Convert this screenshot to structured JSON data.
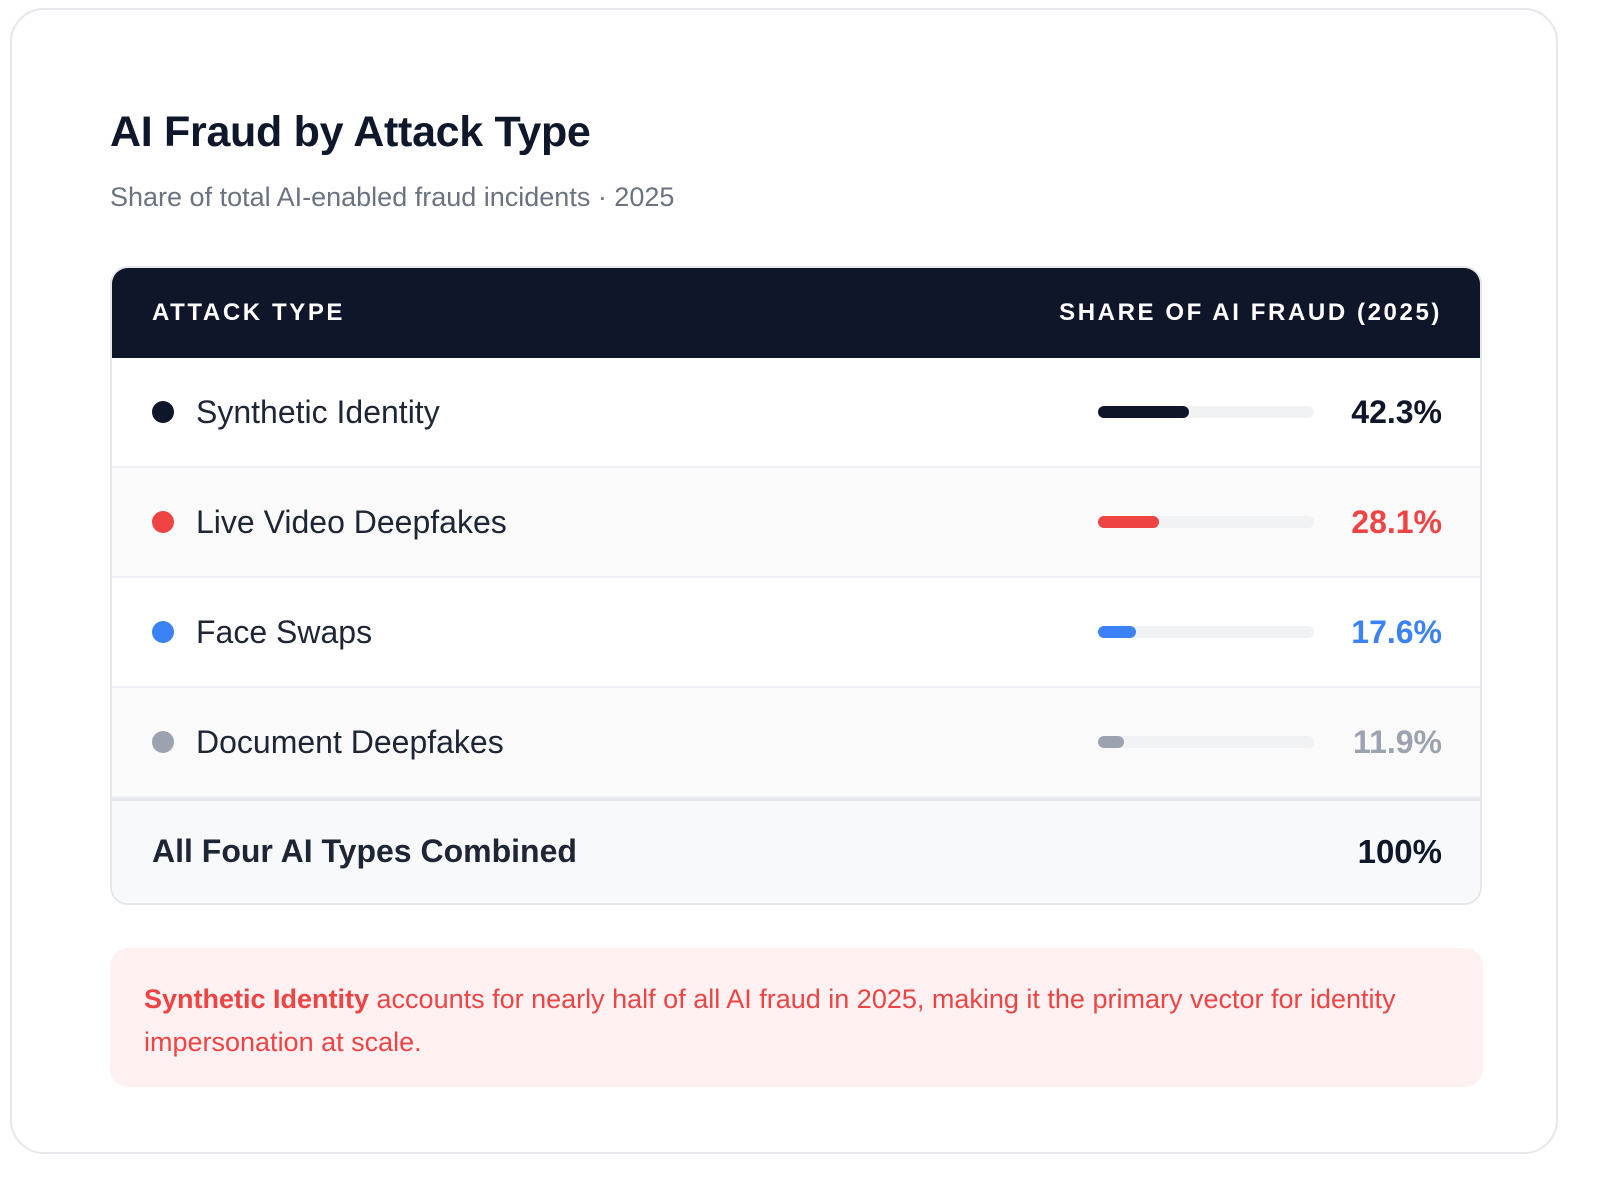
{
  "title": "AI Fraud by Attack Type",
  "subtitle": "Share of total AI-enabled fraud incidents · 2025",
  "table": {
    "col_left": "ATTACK TYPE",
    "col_right": "SHARE OF AI FRAUD (2025)",
    "rows": [
      {
        "label": "Synthetic Identity",
        "value": 42.3,
        "value_label": "42.3%",
        "color": "#0f1629"
      },
      {
        "label": "Live Video Deepfakes",
        "value": 28.1,
        "value_label": "28.1%",
        "color": "#ef4444"
      },
      {
        "label": "Face Swaps",
        "value": 17.6,
        "value_label": "17.6%",
        "color": "#3b82f6"
      },
      {
        "label": "Document Deepfakes",
        "value": 11.9,
        "value_label": "11.9%",
        "color": "#9ca3af"
      }
    ],
    "total_label": "All Four AI Types Combined",
    "total_value": "100%"
  },
  "note": {
    "highlight": "Synthetic Identity",
    "text": " accounts for nearly half of all AI fraud in 2025, making it the primary vector for identity impersonation at scale."
  },
  "chart_data": {
    "type": "table",
    "categories": [
      "Synthetic Identity",
      "Live Video Deepfakes",
      "Face Swaps",
      "Document Deepfakes"
    ],
    "values": [
      42.3,
      28.1,
      17.6,
      11.9
    ],
    "title": "AI Fraud by Attack Type",
    "subtitle": "Share of total AI-enabled fraud incidents · 2025",
    "ylabel": "SHARE OF AI FRAUD (2025)",
    "ylim": [
      0,
      100
    ]
  }
}
